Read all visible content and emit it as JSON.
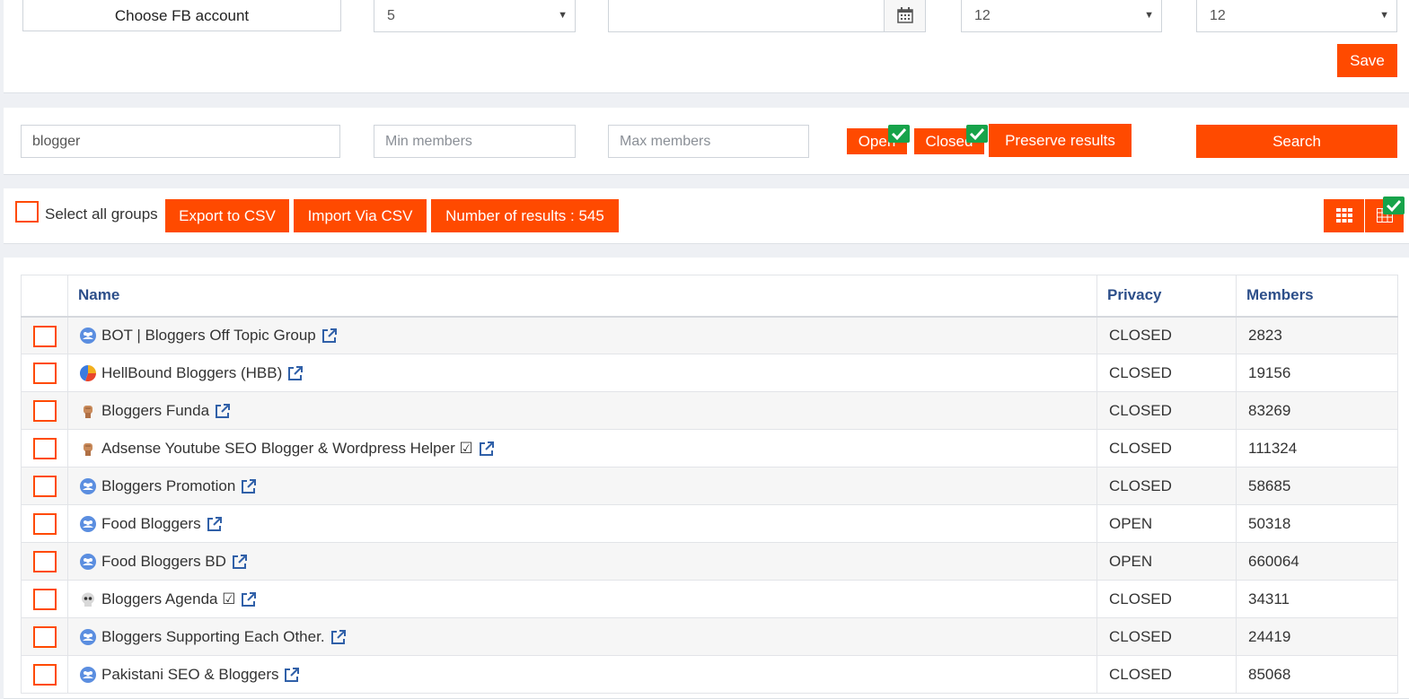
{
  "settings": {
    "account_button": "Choose FB account",
    "select_a": "5",
    "date_value": "",
    "select_b": "12",
    "select_c": "12",
    "save_label": "Save"
  },
  "search": {
    "keyword": "blogger",
    "min_placeholder": "Min members",
    "max_placeholder": "Max members",
    "open_label": "Open",
    "closed_label": "Closed",
    "preserve_label": "Preserve results",
    "search_label": "Search"
  },
  "actions": {
    "select_all_label": "Select all groups",
    "export_label": "Export to CSV",
    "import_label": "Import Via CSV",
    "results_label": "Number of results : 545"
  },
  "table": {
    "headers": [
      "Name",
      "Privacy",
      "Members"
    ],
    "rows": [
      {
        "name": "BOT | Bloggers Off Topic Group",
        "privacy": "CLOSED",
        "members": "2823",
        "icon": "group-icon"
      },
      {
        "name": "HellBound Bloggers (HBB)",
        "privacy": "CLOSED",
        "members": "19156",
        "icon": "pie-logo-icon"
      },
      {
        "name": "Bloggers Funda",
        "privacy": "CLOSED",
        "members": "83269",
        "icon": "fist-icon"
      },
      {
        "name": "Adsense Youtube SEO Blogger & Wordpress Helper ☑",
        "privacy": "CLOSED",
        "members": "111324",
        "icon": "fist-icon"
      },
      {
        "name": "Bloggers Promotion",
        "privacy": "CLOSED",
        "members": "58685",
        "icon": "group-icon"
      },
      {
        "name": "Food Bloggers",
        "privacy": "OPEN",
        "members": "50318",
        "icon": "group-icon"
      },
      {
        "name": "Food Bloggers BD",
        "privacy": "OPEN",
        "members": "660064",
        "icon": "group-icon"
      },
      {
        "name": "Bloggers Agenda ☑",
        "privacy": "CLOSED",
        "members": "34311",
        "icon": "skull-icon"
      },
      {
        "name": "Bloggers Supporting Each Other.",
        "privacy": "CLOSED",
        "members": "24419",
        "icon": "group-icon"
      },
      {
        "name": "Pakistani SEO & Bloggers",
        "privacy": "CLOSED",
        "members": "85068",
        "icon": "group-icon"
      }
    ]
  },
  "colors": {
    "accent": "#ff4a00",
    "check_green": "#17a34a",
    "header_text": "#2d4f8a",
    "link": "#3060a8"
  }
}
